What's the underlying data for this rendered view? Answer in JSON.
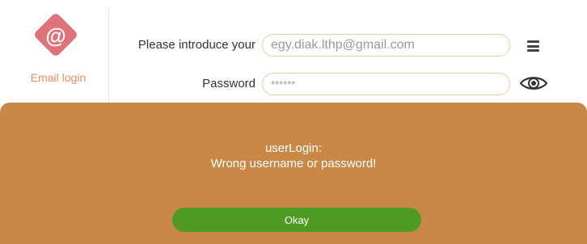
{
  "logo": {
    "symbol": "@",
    "label": "Email login",
    "color": "#e0737a",
    "icon": "at-sign-icon"
  },
  "form": {
    "email_label": "Please introduce your",
    "email_value": "egy.diak.lthp@gmail.com",
    "password_label": "Password",
    "password_value": "******",
    "menu_icon": "hamburger-menu-icon",
    "visibility_icon": "eye-icon"
  },
  "dialog": {
    "title": "userLogin:",
    "message": "Wrong username or password!",
    "button_label": "Okay",
    "background_color": "#c98846",
    "button_color": "#4f9a23"
  }
}
